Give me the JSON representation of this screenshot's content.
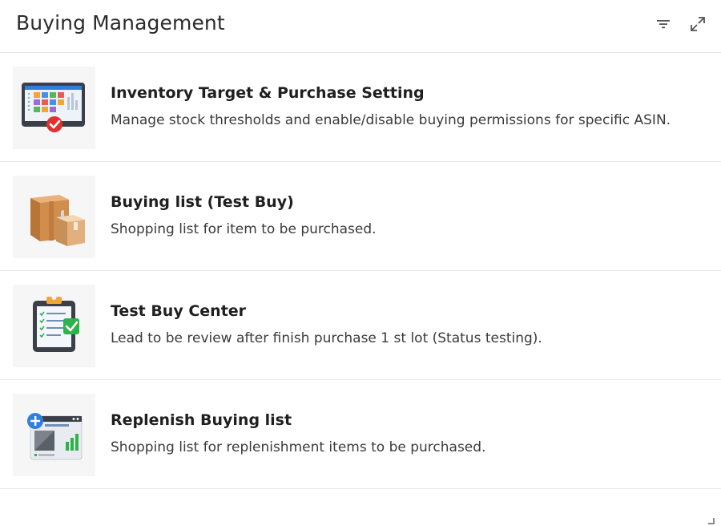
{
  "header": {
    "title": "Buying Management",
    "filter_icon": "filter-icon",
    "expand_icon": "expand-icon"
  },
  "items": [
    {
      "title": "Inventory Target & Purchase Setting",
      "description": "Manage stock thresholds and enable/disable buying permissions for specific ASIN.",
      "icon": "dashboard-checkmark-icon"
    },
    {
      "title": "Buying list (Test Buy)",
      "description": "Shopping list for item to be purchased.",
      "icon": "cardboard-boxes-icon"
    },
    {
      "title": "Test Buy Center",
      "description": "Lead to be review after finish purchase 1 st lot (Status testing).",
      "icon": "clipboard-checklist-icon"
    },
    {
      "title": "Replenish Buying list",
      "description": "Shopping list for replenishment items to be purchased.",
      "icon": "replenish-chart-icon"
    }
  ],
  "colors": {
    "accent_blue": "#2f7fe0",
    "check_red": "#e0312f",
    "check_green": "#2db34a",
    "border": "#e6e6e6"
  }
}
